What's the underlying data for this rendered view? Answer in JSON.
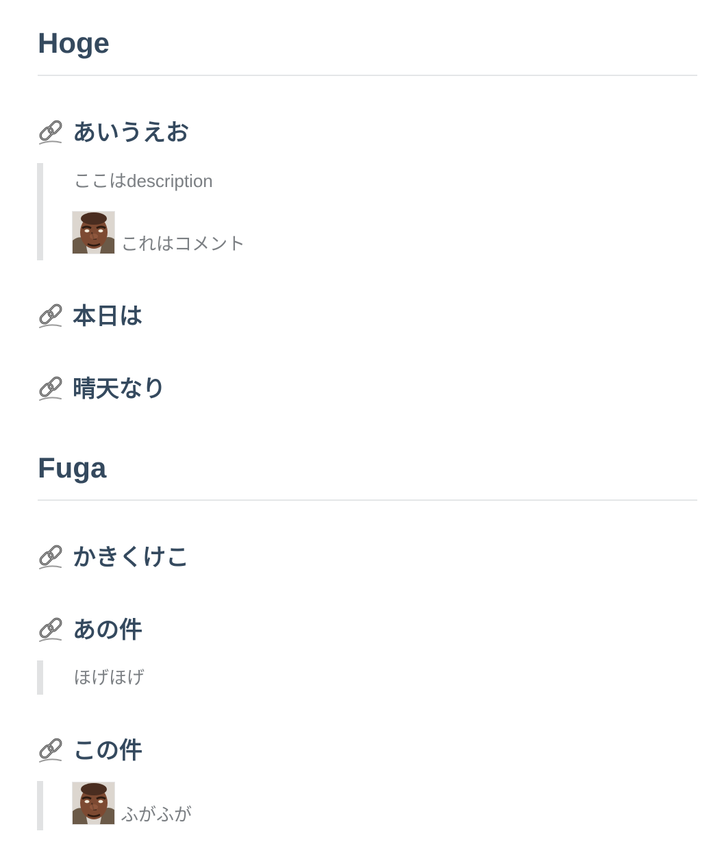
{
  "sections": [
    {
      "title": "Hoge",
      "items": [
        {
          "title": "あいうえお",
          "description": "ここはdescription",
          "comment": "これはコメント"
        },
        {
          "title": "本日は"
        },
        {
          "title": "晴天なり"
        }
      ]
    },
    {
      "title": "Fuga",
      "items": [
        {
          "title": "かきくけこ"
        },
        {
          "title": "あの件",
          "description": "ほげほげ"
        },
        {
          "title": "この件",
          "comment": "ふがふが"
        }
      ]
    }
  ],
  "icons": {
    "anchor": "link-icon",
    "avatar": "avatar-icon"
  },
  "colors": {
    "heading": "#34495e",
    "muted_text": "#7b7f83",
    "rule": "#e4e6e8",
    "quote_border": "#e1e2e3"
  }
}
